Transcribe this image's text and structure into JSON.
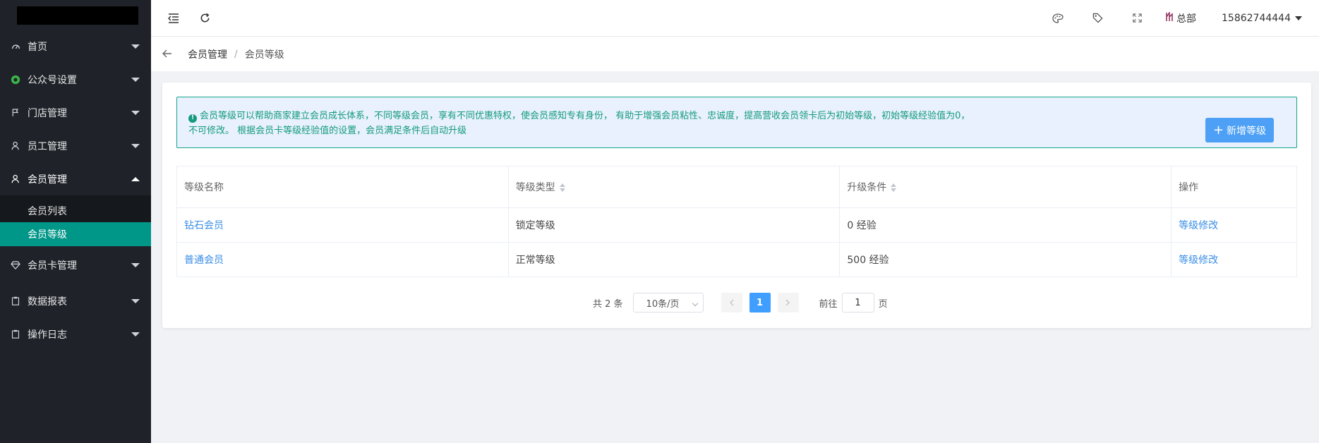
{
  "sidebar": {
    "items": [
      {
        "label": "首页",
        "icon": "dashboard-icon"
      },
      {
        "label": "公众号设置",
        "icon": "wechat-icon"
      },
      {
        "label": "门店管理",
        "icon": "flag-icon"
      },
      {
        "label": "员工管理",
        "icon": "user-icon"
      },
      {
        "label": "会员管理",
        "icon": "member-icon",
        "open": true,
        "children": [
          {
            "label": "会员列表"
          },
          {
            "label": "会员等级",
            "active": true
          }
        ]
      },
      {
        "label": "会员卡管理",
        "icon": "diamond-icon"
      },
      {
        "label": "数据报表",
        "icon": "clipboard-icon"
      },
      {
        "label": "操作日志",
        "icon": "log-icon"
      }
    ]
  },
  "header": {
    "store_name": "总部",
    "username": "15862744444"
  },
  "breadcrumb": {
    "items": [
      "会员管理",
      "会员等级"
    ]
  },
  "notice": {
    "text": "会员等级可以帮助商家建立会员成长体系，不同等级会员，享有不同优惠特权，使会员感知专有身份， 有助于增强会员粘性、忠诚度，提高营收会员领卡后为初始等级，初始等级经验值为0，不可修改。 根据会员卡等级经验值的设置，会员满足条件后自动升级"
  },
  "add_button": {
    "label": "新增等级"
  },
  "table": {
    "columns": [
      "等级名称",
      "等级类型",
      "升级条件",
      "操作"
    ],
    "rows": [
      {
        "name": "钻石会员",
        "type": "锁定等级",
        "condition": "0 经验",
        "action": "等级修改"
      },
      {
        "name": "普通会员",
        "type": "正常等级",
        "condition": "500 经验",
        "action": "等级修改"
      }
    ]
  },
  "pagination": {
    "total_text": "共 2 条",
    "page_size": "10条/页",
    "current_page": "1",
    "goto_label": "前往",
    "goto_value": "1",
    "page_unit": "页"
  },
  "colors": {
    "sidebar_bg": "#1f2329",
    "active_menu": "#009688",
    "primary": "#409eff",
    "notice_text": "#159a80"
  }
}
